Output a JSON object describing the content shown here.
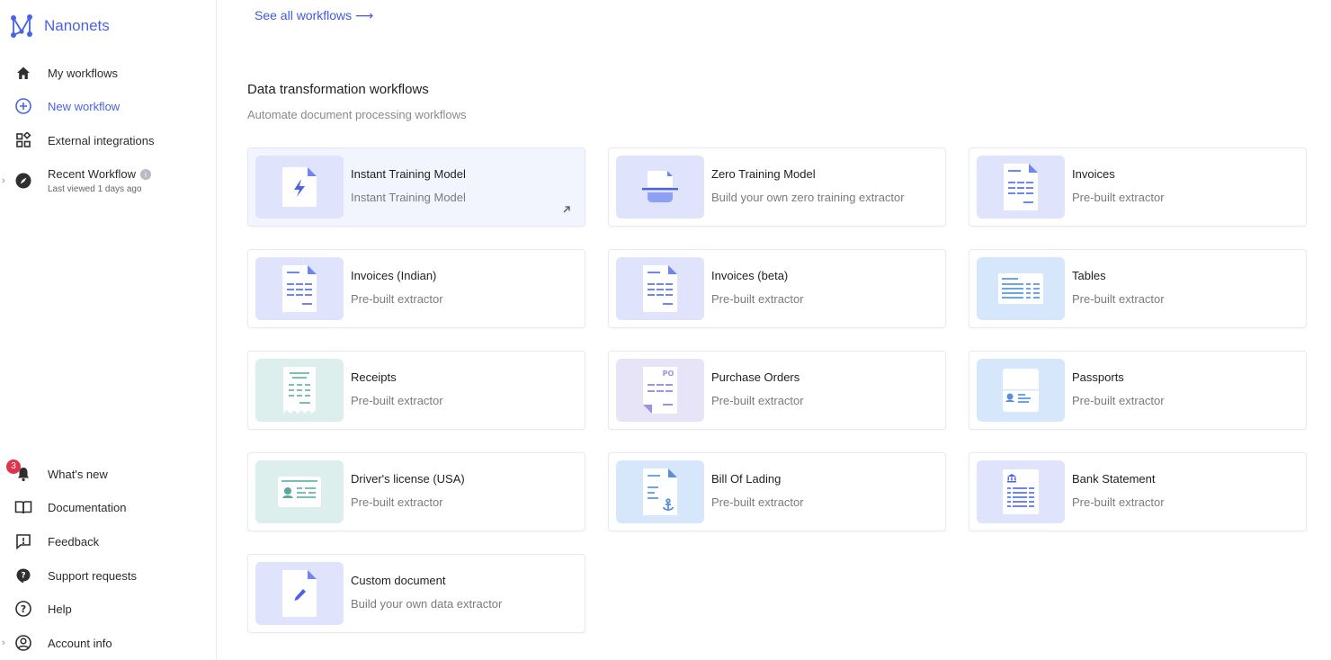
{
  "brand": {
    "name": "Nanonets"
  },
  "sidebar": {
    "top_items": [
      {
        "label": "My workflows",
        "icon": "home-icon"
      },
      {
        "label": "New workflow",
        "icon": "plus-circle-icon",
        "active": true
      },
      {
        "label": "External integrations",
        "icon": "apps-grid-icon"
      }
    ],
    "recent": {
      "title": "Recent Workflow",
      "info": "i",
      "subtitle": "Last viewed 1 days ago"
    },
    "bottom_items": [
      {
        "label": "What's new",
        "icon": "bell-icon",
        "badge": "3"
      },
      {
        "label": "Documentation",
        "icon": "book-icon"
      },
      {
        "label": "Feedback",
        "icon": "feedback-icon"
      },
      {
        "label": "Support requests",
        "icon": "support-icon"
      },
      {
        "label": "Help",
        "icon": "help-icon"
      },
      {
        "label": "Account info",
        "icon": "account-icon"
      }
    ]
  },
  "main": {
    "see_all": "See all workflows ⟶",
    "section_title": "Data transformation workflows",
    "section_subtitle": "Automate document processing workflows",
    "cards": [
      {
        "title": "Instant Training Model",
        "subtitle": "Instant Training Model",
        "icon": "lightning-doc-icon"
      },
      {
        "title": "Zero Training Model",
        "subtitle": "Build your own zero training extractor",
        "icon": "scanner-icon"
      },
      {
        "title": "Invoices",
        "subtitle": "Pre-built extractor",
        "icon": "invoice-icon"
      },
      {
        "title": "Invoices (Indian)",
        "subtitle": "Pre-built extractor",
        "icon": "invoice-icon"
      },
      {
        "title": "Invoices (beta)",
        "subtitle": "Pre-built extractor",
        "icon": "invoice-icon"
      },
      {
        "title": "Tables",
        "subtitle": "Pre-built extractor",
        "icon": "table-icon"
      },
      {
        "title": "Receipts",
        "subtitle": "Pre-built extractor",
        "icon": "receipt-icon"
      },
      {
        "title": "Purchase Orders",
        "subtitle": "Pre-built extractor",
        "icon": "purchase-order-icon"
      },
      {
        "title": "Passports",
        "subtitle": "Pre-built extractor",
        "icon": "passport-icon"
      },
      {
        "title": "Driver's license (USA)",
        "subtitle": "Pre-built extractor",
        "icon": "id-card-icon"
      },
      {
        "title": "Bill Of Lading",
        "subtitle": "Pre-built extractor",
        "icon": "anchor-doc-icon"
      },
      {
        "title": "Bank Statement",
        "subtitle": "Pre-built extractor",
        "icon": "bank-statement-icon"
      },
      {
        "title": "Custom document",
        "subtitle": "Build your own data extractor",
        "icon": "pencil-doc-icon"
      }
    ]
  },
  "colors": {
    "accent": "#4a63e6",
    "link": "#3d5ae0",
    "badge": "#e0344b"
  }
}
